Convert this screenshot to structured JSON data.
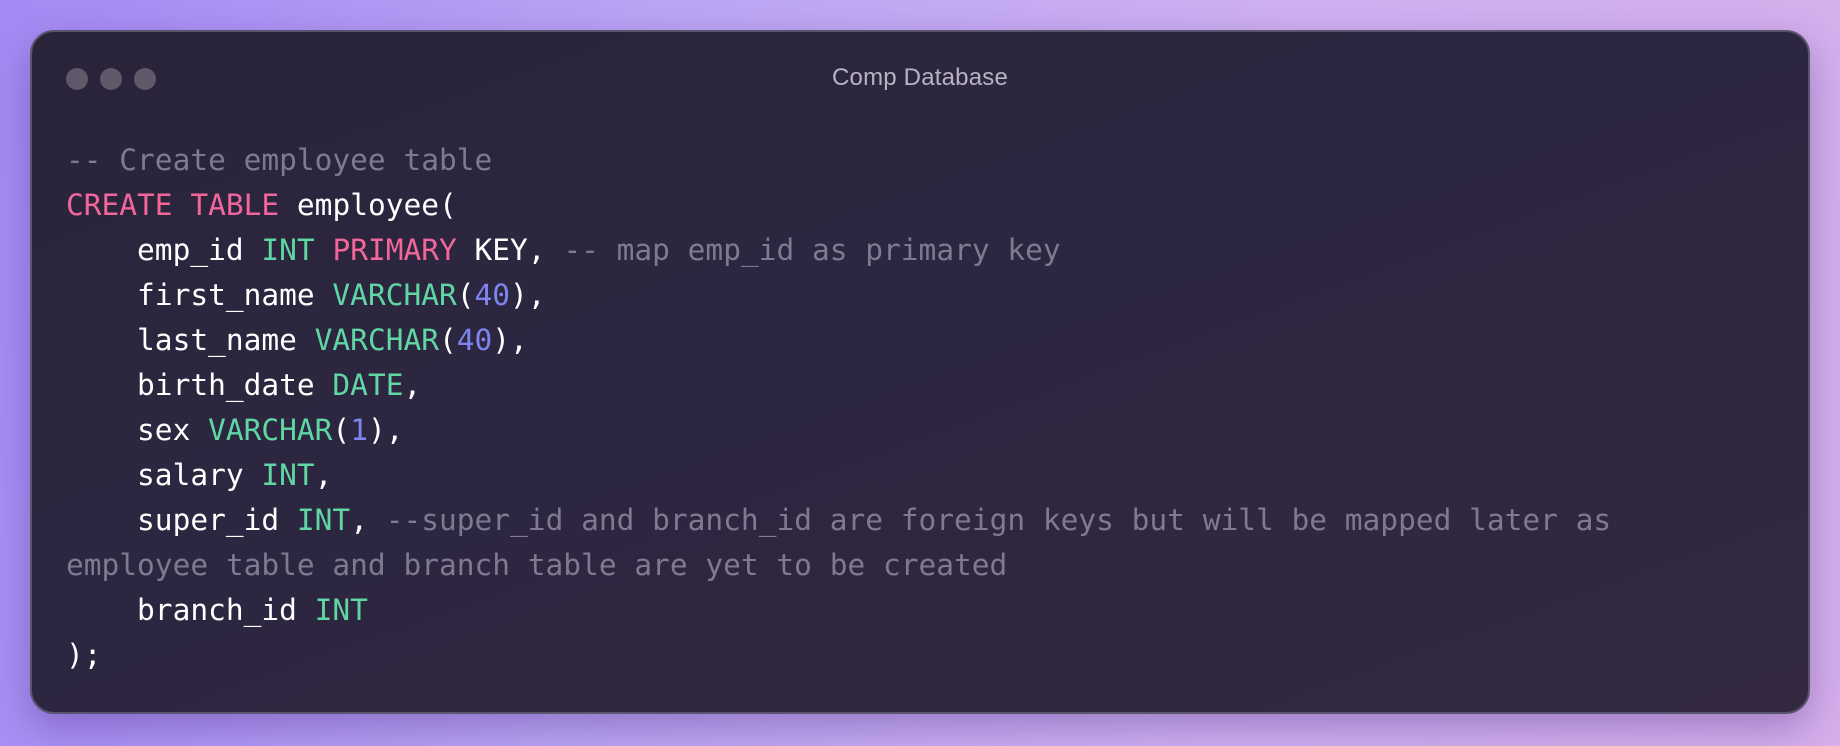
{
  "window": {
    "title": "Comp Database",
    "colors": {
      "comment": "#7f7991",
      "keyword": "#f2669a",
      "type": "#5fd6a3",
      "number": "#7e84f0",
      "text": "#ffffff"
    }
  },
  "code": {
    "lines": [
      [
        {
          "t": "-- Create employee table",
          "c": "cm"
        }
      ],
      [
        {
          "t": "CREATE",
          "c": "kw"
        },
        {
          "t": " ",
          "c": "pl"
        },
        {
          "t": "TABLE",
          "c": "kw"
        },
        {
          "t": " employee(",
          "c": "pl"
        }
      ],
      [
        {
          "t": "    emp_id ",
          "c": "pl"
        },
        {
          "t": "INT",
          "c": "ty"
        },
        {
          "t": " ",
          "c": "pl"
        },
        {
          "t": "PRIMARY",
          "c": "kw"
        },
        {
          "t": " KEY, ",
          "c": "pl"
        },
        {
          "t": "-- map emp_id as primary key",
          "c": "cm"
        }
      ],
      [
        {
          "t": "    first_name ",
          "c": "pl"
        },
        {
          "t": "VARCHAR",
          "c": "ty"
        },
        {
          "t": "(",
          "c": "pl"
        },
        {
          "t": "40",
          "c": "nm"
        },
        {
          "t": "),",
          "c": "pl"
        }
      ],
      [
        {
          "t": "    last_name ",
          "c": "pl"
        },
        {
          "t": "VARCHAR",
          "c": "ty"
        },
        {
          "t": "(",
          "c": "pl"
        },
        {
          "t": "40",
          "c": "nm"
        },
        {
          "t": "),",
          "c": "pl"
        }
      ],
      [
        {
          "t": "    birth_date ",
          "c": "pl"
        },
        {
          "t": "DATE",
          "c": "ty"
        },
        {
          "t": ",",
          "c": "pl"
        }
      ],
      [
        {
          "t": "    sex ",
          "c": "pl"
        },
        {
          "t": "VARCHAR",
          "c": "ty"
        },
        {
          "t": "(",
          "c": "pl"
        },
        {
          "t": "1",
          "c": "nm"
        },
        {
          "t": "),",
          "c": "pl"
        }
      ],
      [
        {
          "t": "    salary ",
          "c": "pl"
        },
        {
          "t": "INT",
          "c": "ty"
        },
        {
          "t": ",",
          "c": "pl"
        }
      ],
      [
        {
          "t": "    super_id ",
          "c": "pl"
        },
        {
          "t": "INT",
          "c": "ty"
        },
        {
          "t": ", ",
          "c": "pl"
        },
        {
          "t": "--super_id and branch_id are foreign keys but will be mapped later as",
          "c": "cm"
        }
      ],
      [
        {
          "t": "employee table and branch table are yet to be created",
          "c": "cm"
        }
      ],
      [
        {
          "t": "    branch_id ",
          "c": "pl"
        },
        {
          "t": "INT",
          "c": "ty"
        }
      ],
      [
        {
          "t": ");",
          "c": "pl"
        }
      ]
    ]
  }
}
